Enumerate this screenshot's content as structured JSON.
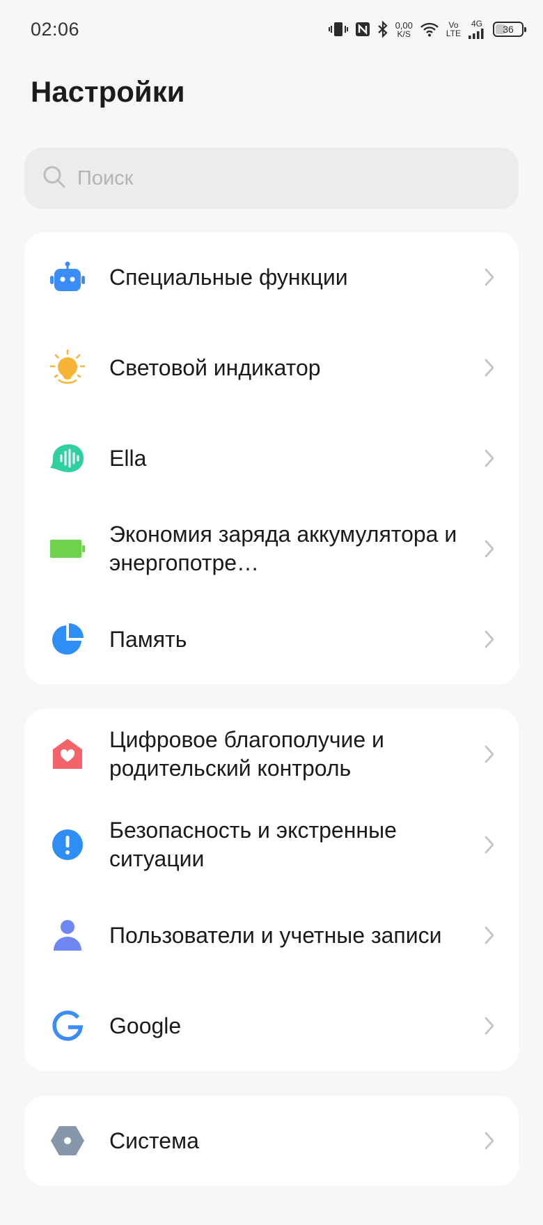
{
  "status_bar": {
    "time": "02:06",
    "net_speed_value": "0,00",
    "net_speed_unit": "K/S",
    "volte_top": "Vo",
    "volte_bottom": "LTE",
    "network": "4G",
    "battery": "36"
  },
  "page": {
    "title": "Настройки"
  },
  "search": {
    "placeholder": "Поиск"
  },
  "groups": [
    {
      "items": [
        {
          "label": "Специальные функции",
          "icon": "robot-icon",
          "color": "#3b8cf5"
        },
        {
          "label": "Световой индикатор",
          "icon": "light-bulb-icon",
          "color": "#f8b437"
        },
        {
          "label": "Ella",
          "icon": "voice-assistant-icon",
          "color": "#2fcf9f"
        },
        {
          "label": "Экономия заряда аккумулятора и энергопотре…",
          "icon": "battery-icon",
          "color": "#6dd34a"
        },
        {
          "label": "Память",
          "icon": "storage-pie-icon",
          "color": "#2f8ef5"
        }
      ]
    },
    {
      "items": [
        {
          "label": "Цифровое благополучие и родительский контроль",
          "icon": "wellbeing-house-icon",
          "color": "#f4626a"
        },
        {
          "label": "Безопасность и экстренные ситуации",
          "icon": "alert-icon",
          "color": "#2f8ef5"
        },
        {
          "label": "Пользователи и учетные записи",
          "icon": "user-icon",
          "color": "#6f86f5"
        },
        {
          "label": "Google",
          "icon": "google-icon",
          "color": "#3b8cf5"
        }
      ]
    },
    {
      "items": [
        {
          "label": "Система",
          "icon": "system-hexagon-icon",
          "color": "#8797ab"
        }
      ]
    }
  ]
}
